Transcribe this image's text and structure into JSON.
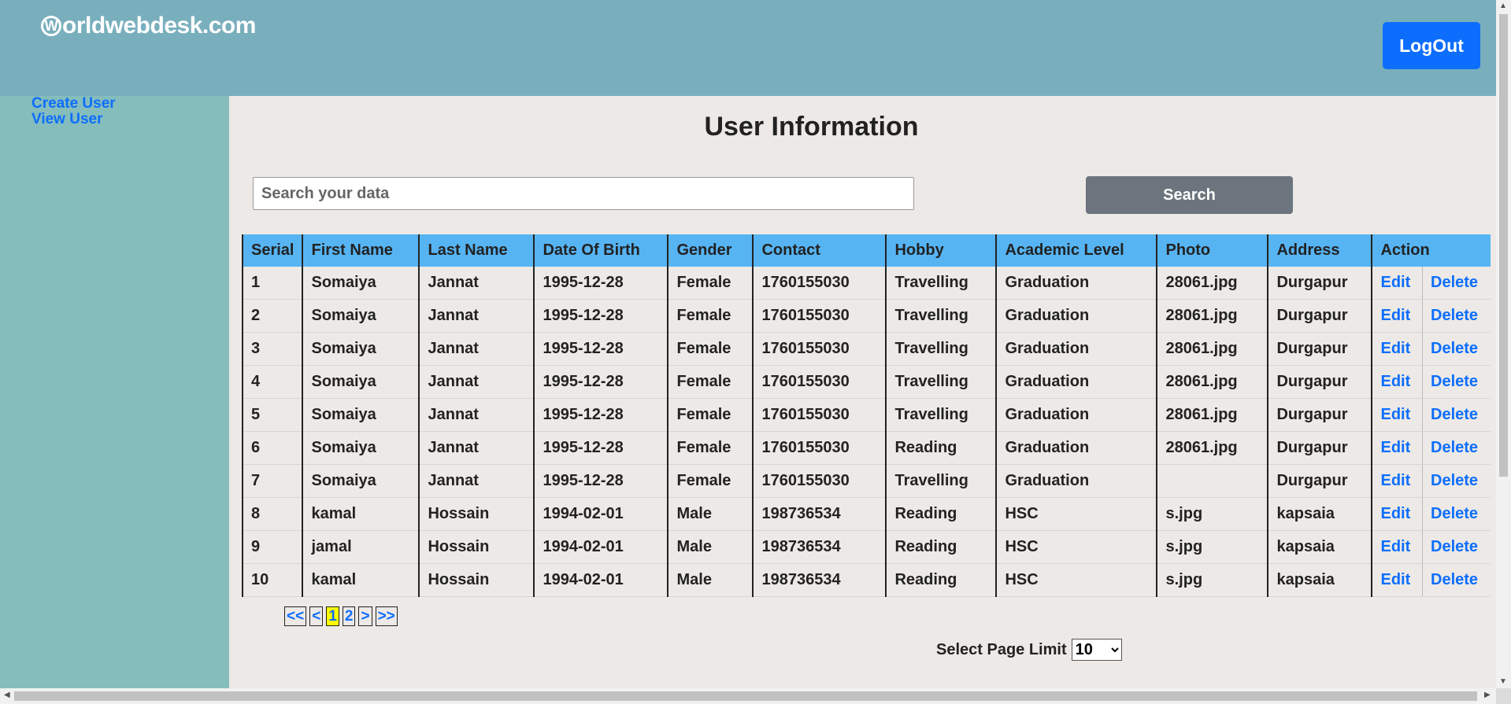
{
  "header": {
    "logo_mark": "W",
    "logo_text": "orldwebdesk.com",
    "logout_label": "LogOut"
  },
  "sidebar": {
    "items": [
      {
        "label": "Create User"
      },
      {
        "label": "View User"
      }
    ]
  },
  "main": {
    "title": "User Information",
    "search": {
      "placeholder": "Search your data",
      "value": "",
      "button_label": "Search"
    },
    "table": {
      "columns": [
        "Serial",
        "First Name",
        "Last Name",
        "Date Of Birth",
        "Gender",
        "Contact",
        "Hobby",
        "Academic Level",
        "Photo",
        "Address",
        "Action"
      ],
      "rows": [
        [
          "1",
          "Somaiya",
          "Jannat",
          "1995-12-28",
          "Female",
          "1760155030",
          "Travelling",
          "Graduation",
          "28061.jpg",
          "Durgapur",
          "Edit",
          "Delete"
        ],
        [
          "2",
          "Somaiya",
          "Jannat",
          "1995-12-28",
          "Female",
          "1760155030",
          "Travelling",
          "Graduation",
          "28061.jpg",
          "Durgapur",
          "Edit",
          "Delete"
        ],
        [
          "3",
          "Somaiya",
          "Jannat",
          "1995-12-28",
          "Female",
          "1760155030",
          "Travelling",
          "Graduation",
          "28061.jpg",
          "Durgapur",
          "Edit",
          "Delete"
        ],
        [
          "4",
          "Somaiya",
          "Jannat",
          "1995-12-28",
          "Female",
          "1760155030",
          "Travelling",
          "Graduation",
          "28061.jpg",
          "Durgapur",
          "Edit",
          "Delete"
        ],
        [
          "5",
          "Somaiya",
          "Jannat",
          "1995-12-28",
          "Female",
          "1760155030",
          "Travelling",
          "Graduation",
          "28061.jpg",
          "Durgapur",
          "Edit",
          "Delete"
        ],
        [
          "6",
          "Somaiya",
          "Jannat",
          "1995-12-28",
          "Female",
          "1760155030",
          "Reading",
          "Graduation",
          "28061.jpg",
          "Durgapur",
          "Edit",
          "Delete"
        ],
        [
          "7",
          "Somaiya",
          "Jannat",
          "1995-12-28",
          "Female",
          "1760155030",
          "Travelling",
          "Graduation",
          "",
          "Durgapur",
          "Edit",
          "Delete"
        ],
        [
          "8",
          "kamal",
          "Hossain",
          "1994-02-01",
          "Male",
          "198736534",
          "Reading",
          "HSC",
          "s.jpg",
          "kapsaia",
          "Edit",
          "Delete"
        ],
        [
          "9",
          "jamal",
          "Hossain",
          "1994-02-01",
          "Male",
          "198736534",
          "Reading",
          "HSC",
          "s.jpg",
          "kapsaia",
          "Edit",
          "Delete"
        ],
        [
          "10",
          "kamal",
          "Hossain",
          "1994-02-01",
          "Male",
          "198736534",
          "Reading",
          "HSC",
          "s.jpg",
          "kapsaia",
          "Edit",
          "Delete"
        ]
      ]
    },
    "pagination": {
      "items": [
        {
          "label": "<<",
          "name": "page-first-link",
          "active": false
        },
        {
          "label": "<",
          "name": "page-prev-link",
          "active": false
        },
        {
          "label": "1",
          "name": "page-1-link",
          "active": true
        },
        {
          "label": "2",
          "name": "page-2-link",
          "active": false
        },
        {
          "label": ">",
          "name": "page-next-link",
          "active": false
        },
        {
          "label": ">>",
          "name": "page-last-link",
          "active": false
        }
      ]
    },
    "page_limit": {
      "label": "Select Page Limit",
      "selected": "10",
      "options": [
        "10"
      ]
    }
  },
  "colors": {
    "header_bg": "#79afbd",
    "sidebar_bg": "#85bdbc",
    "content_bg": "#ece9e6",
    "table_header_bg": "#56b4f3",
    "link": "#0d6efd",
    "search_button": "#6c757d",
    "active_page": "#ffff00"
  }
}
